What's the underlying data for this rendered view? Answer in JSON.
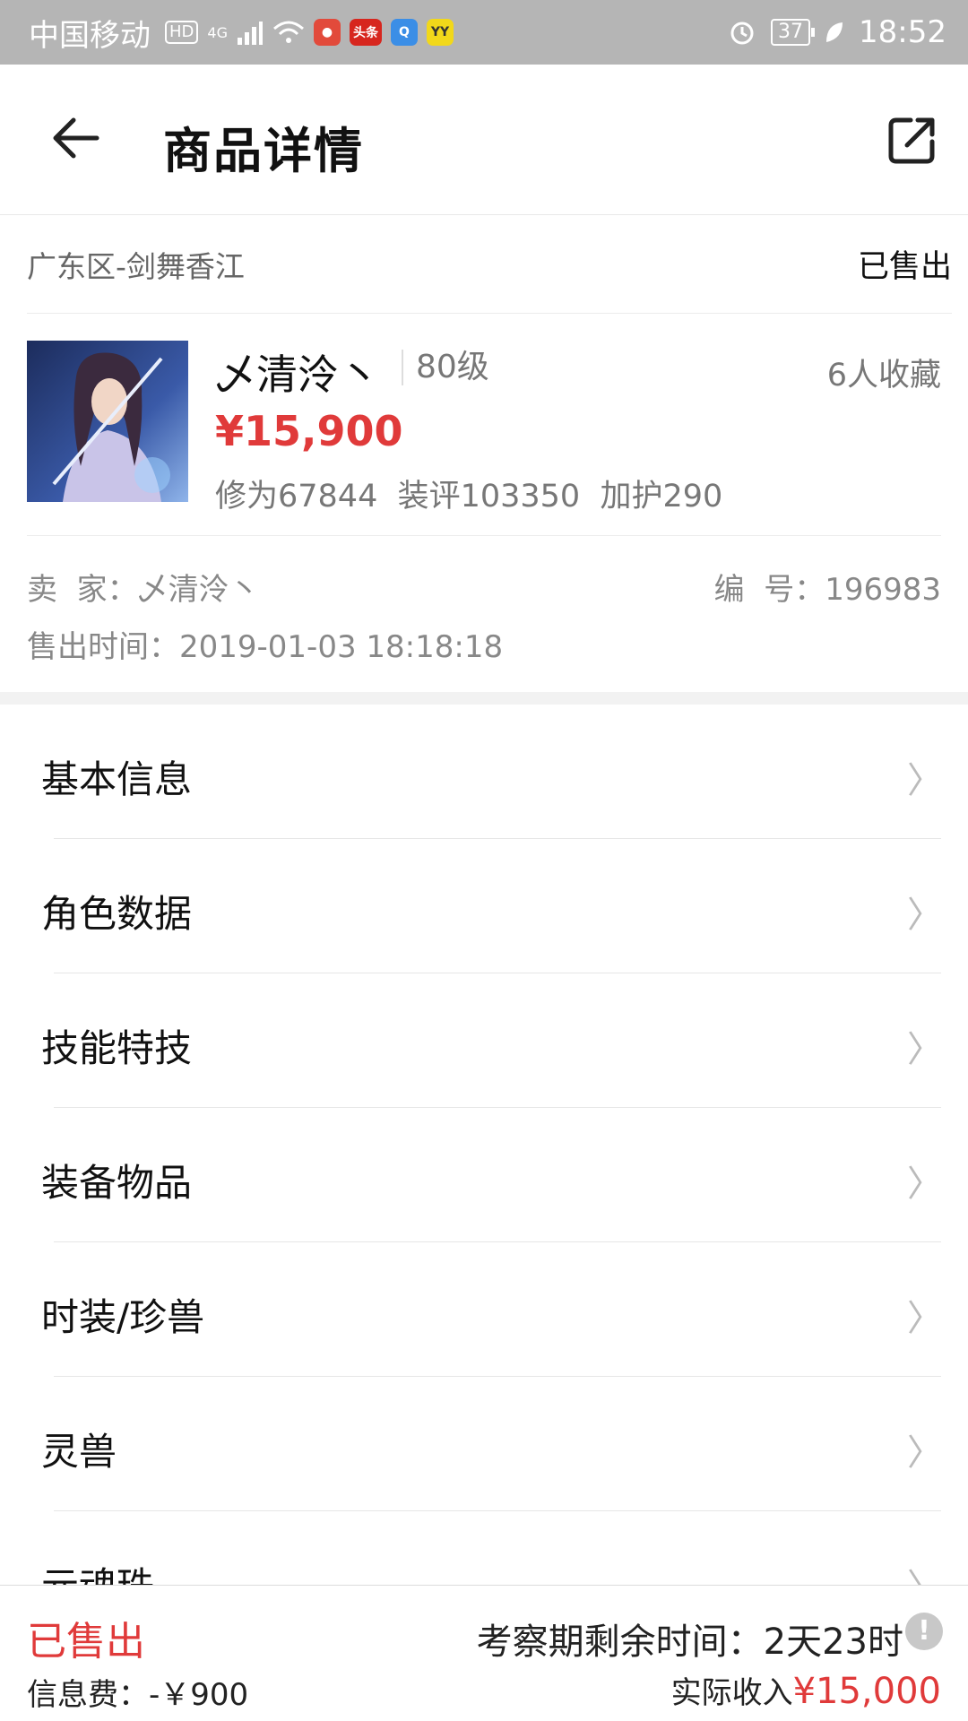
{
  "status_bar": {
    "carrier": "中国移动",
    "hd": "HD",
    "network": "4G",
    "apps": [
      "toutiao",
      "头条",
      "qq",
      "YY"
    ],
    "battery": "37",
    "time": "18:52"
  },
  "header": {
    "title": "商品详情"
  },
  "region": {
    "server": "广东区-剑舞香江",
    "status": "已售出"
  },
  "product": {
    "name": "乄清泠丶",
    "level": "80级",
    "favorites": "6人收藏",
    "price": "¥15,900",
    "stats": "修为67844  装评103350  加护290"
  },
  "seller": {
    "seller_label": "卖  家：乄清泠丶",
    "id_label": "编  号：196983",
    "sold_time": "售出时间：2019-01-03 18:18:18"
  },
  "menu": {
    "items": [
      {
        "label": "基本信息"
      },
      {
        "label": "角色数据"
      },
      {
        "label": "技能特技"
      },
      {
        "label": "装备物品"
      },
      {
        "label": "时装/珍兽"
      },
      {
        "label": "灵兽"
      },
      {
        "label": "元魂珠"
      }
    ],
    "chevron": "〉"
  },
  "footer": {
    "sold": "已售出",
    "fee": "信息费：-￥900",
    "remaining": "考察期剩余时间：2天23时",
    "info_icon": "!",
    "income_label": "实际收入",
    "income_amount": "¥15,000"
  },
  "colors": {
    "accent_red": "#e03a3a",
    "status_bar": "#b5b5b5"
  }
}
